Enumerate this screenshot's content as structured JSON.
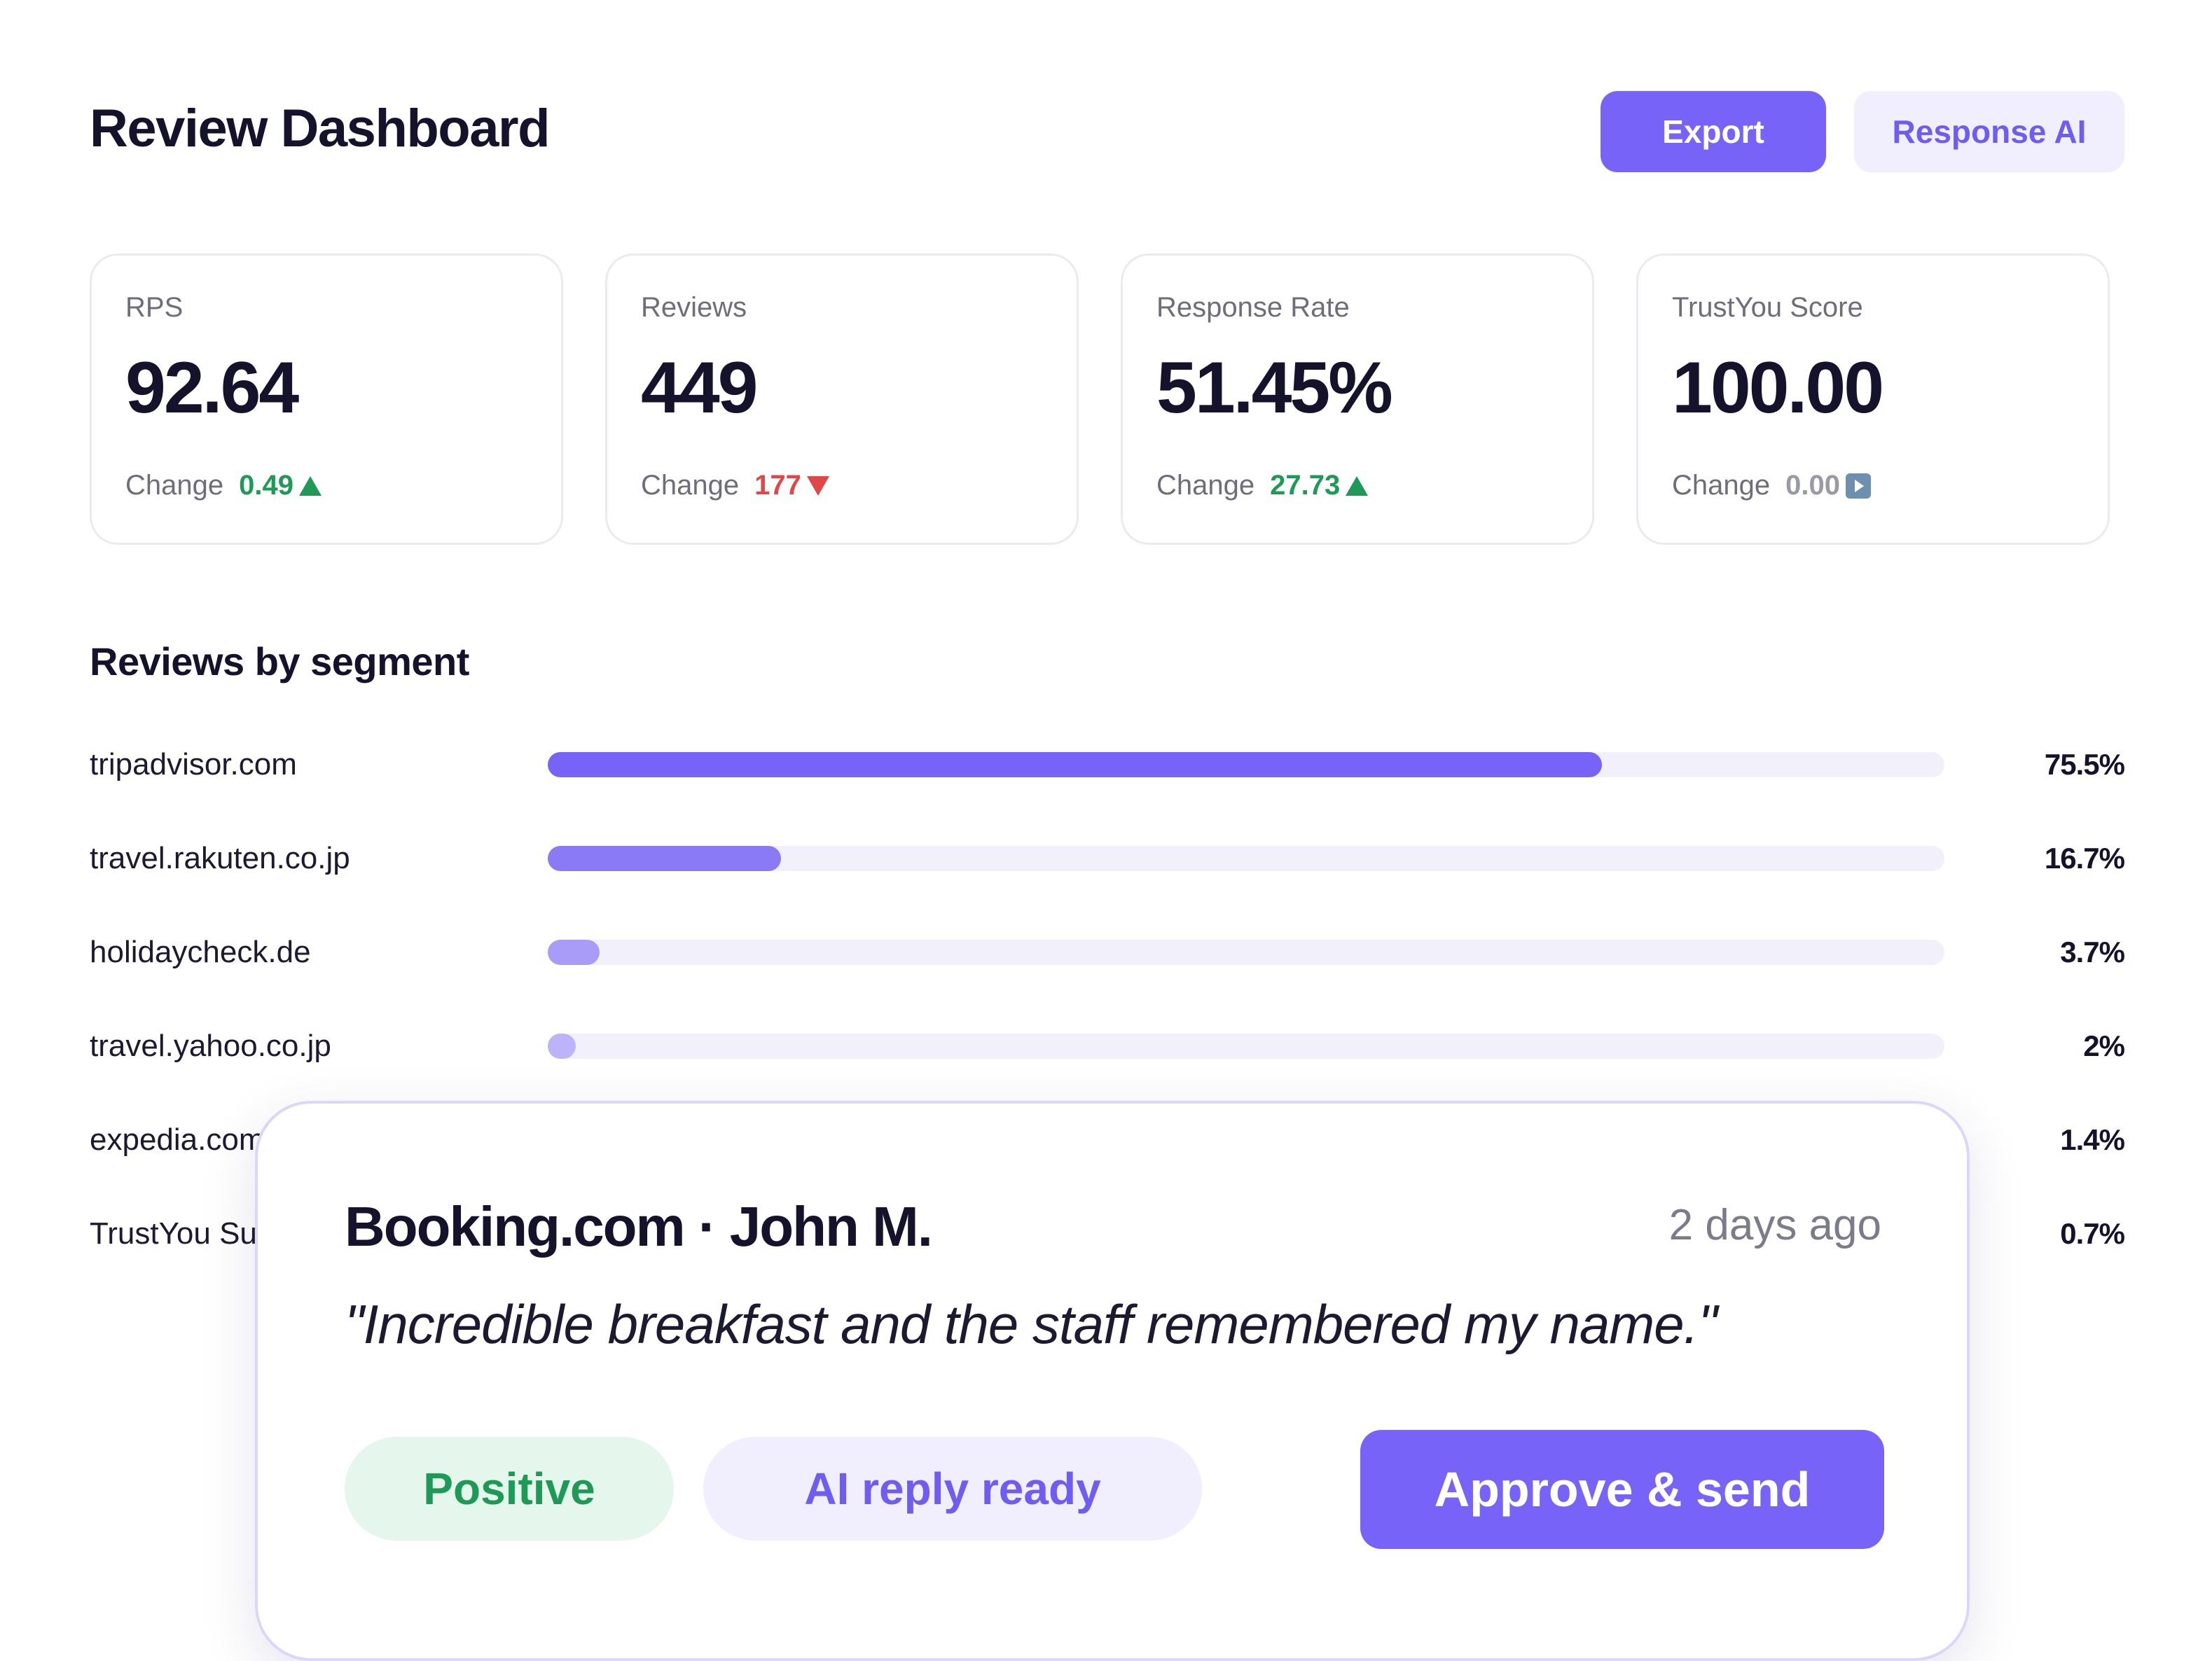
{
  "header": {
    "title": "Review Dashboard",
    "export_label": "Export",
    "response_ai_label": "Response AI"
  },
  "kpis": [
    {
      "label": "RPS",
      "value": "92.64",
      "change_label": "Change",
      "change": "0.49",
      "trend": "up",
      "trend_icon": "triangle-up-icon",
      "color": "#1e9a56"
    },
    {
      "label": "Reviews",
      "value": "449",
      "change_label": "Change",
      "change": "177",
      "trend": "down",
      "trend_icon": "triangle-down-icon",
      "color": "#e04848"
    },
    {
      "label": "Response Rate",
      "value": "51.45%",
      "change_label": "Change",
      "change": "27.73",
      "trend": "up",
      "trend_icon": "triangle-up-icon",
      "color": "#1e9a56"
    },
    {
      "label": "TrustYou Score",
      "value": "100.00",
      "change_label": "Change",
      "change": "0.00",
      "trend": "flat",
      "trend_icon": "play-box-icon",
      "color": "#9a9aa6"
    }
  ],
  "segments": {
    "title": "Reviews by segment",
    "items": [
      {
        "label": "tripadvisor.com",
        "percent": 75.5,
        "value_text": "75.5%",
        "color": "#7763f7"
      },
      {
        "label": "travel.rakuten.co.jp",
        "percent": 16.7,
        "value_text": "16.7%",
        "color": "#8b7af6"
      },
      {
        "label": "holidaycheck.de",
        "percent": 3.7,
        "value_text": "3.7%",
        "color": "#a99cf8"
      },
      {
        "label": "travel.yahoo.co.jp",
        "percent": 2,
        "value_text": "2%",
        "color": "#bdb3fa"
      },
      {
        "label": "expedia.com",
        "percent": 1.4,
        "value_text": "1.4%",
        "color": "#cbc3fb"
      },
      {
        "label": "TrustYou Surveys",
        "percent": 0.7,
        "value_text": "0.7%",
        "color": "#d8d2fc"
      }
    ]
  },
  "review": {
    "source": "Booking.com · John M.",
    "time": "2 days ago",
    "quote": "\"Incredible breakfast and the staff remembered my name.\"",
    "sentiment": "Positive",
    "ai_status": "AI reply ready",
    "approve_label": "Approve & send"
  },
  "colors": {
    "accent": "#7763f7",
    "accent_soft": "#f1effd",
    "positive": "#1e9a56",
    "negative": "#e04848",
    "neutral": "#9a9aa6",
    "track": "#f1f0fb"
  }
}
